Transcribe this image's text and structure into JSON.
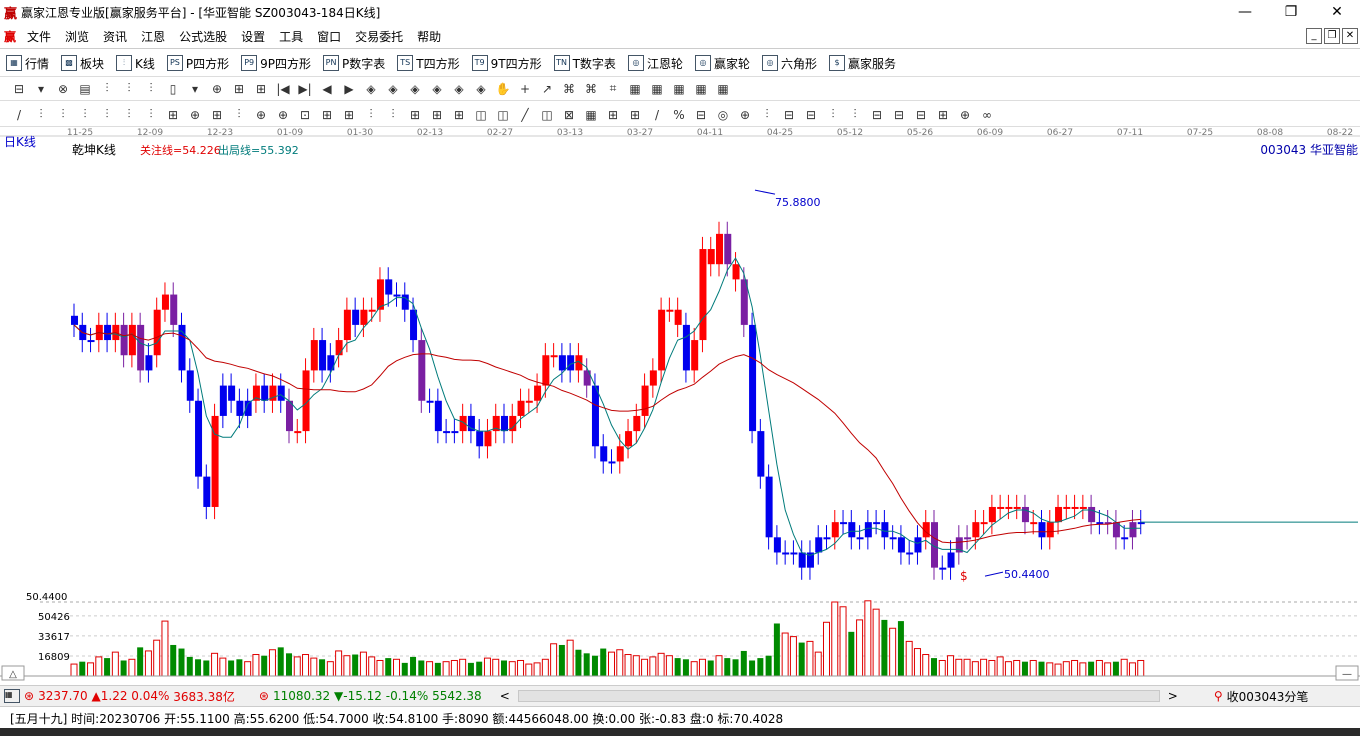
{
  "window": {
    "logo_glyph": "赢",
    "title": "赢家江恩专业版[赢家服务平台] - [华亚智能  SZ003043-184日K线]",
    "minimize": "—",
    "restore": "❐",
    "close": "✕"
  },
  "menu": {
    "items": [
      "文件",
      "浏览",
      "资讯",
      "江恩",
      "公式选股",
      "设置",
      "工具",
      "窗口",
      "交易委托",
      "帮助"
    ]
  },
  "toolbar": {
    "items": [
      {
        "icon": "▦",
        "label": "行情"
      },
      {
        "icon": "▩",
        "label": "板块"
      },
      {
        "icon": "⫶",
        "label": "K线"
      },
      {
        "icon": "PS",
        "label": "P四方形"
      },
      {
        "icon": "P9",
        "label": "9P四方形"
      },
      {
        "icon": "PN",
        "label": "P数字表"
      },
      {
        "icon": "TS",
        "label": "T四方形"
      },
      {
        "icon": "T9",
        "label": "9T四方形"
      },
      {
        "icon": "TN",
        "label": "T数字表"
      },
      {
        "icon": "◎",
        "label": "江恩轮"
      },
      {
        "icon": "◎",
        "label": "赢家轮"
      },
      {
        "icon": "◎",
        "label": "六角形"
      },
      {
        "icon": "$",
        "label": "赢家服务"
      }
    ],
    "row2_icons": [
      "⊟",
      "▾",
      "⊗",
      "▤",
      "⫶",
      "⫶",
      "⫶",
      "▯",
      "▾",
      "⊕",
      "⊞",
      "⊞",
      "|◀",
      "▶|",
      "◀",
      "▶",
      "◈",
      "◈",
      "◈",
      "◈",
      "◈",
      "◈",
      "✋",
      "+",
      "↗",
      "⌘",
      "⌘",
      "⌗",
      "▦",
      "▦",
      "▦",
      "▦",
      "▦"
    ],
    "row3_icons": [
      "/",
      "⫶",
      "⫶",
      "⫶",
      "⫶",
      "⫶",
      "⫶",
      "⊞",
      "⊕",
      "⊞",
      "⫶",
      "⊕",
      "⊕",
      "⊡",
      "⊞",
      "⊞",
      "⫶",
      "⫶",
      "⊞",
      "⊞",
      "⊞",
      "◫",
      "◫",
      "╱",
      "◫",
      "⊠",
      "▦",
      "⊞",
      "⊞",
      "/",
      "%",
      "⊟",
      "◎",
      "⊕",
      "⫶",
      "⊟",
      "⊟",
      "⫶",
      "⫶",
      "⊟",
      "⊟",
      "⊟",
      "⊞",
      "⊕",
      "∞"
    ]
  },
  "chart_header": {
    "period_label": "日K线",
    "indicator_name": "乾坤K线",
    "focus_line_label": "关注线=54.226",
    "exit_line_label": "出局线=55.392",
    "stock_code_name": "003043  华亚智能",
    "high_label": "75.8800",
    "low_label": "50.4400",
    "low_marker": "$",
    "price_axis_label": "50.4400"
  },
  "chart_data": {
    "type": "candlestick",
    "x_dates": [
      "11-25",
      "12-09",
      "12-23",
      "01-09",
      "01-30",
      "02-13",
      "02-27",
      "03-13",
      "03-27",
      "04-11",
      "04-25",
      "05-12",
      "05-26",
      "06-09",
      "06-27",
      "07-11",
      "07-25",
      "08-08",
      "08-22"
    ],
    "volume_axis_ticks": [
      "50426",
      "33617",
      "16809"
    ],
    "high": 75.88,
    "low": 50.44,
    "closes": [
      67,
      66,
      66,
      67,
      66,
      67,
      65,
      67,
      64,
      65,
      68,
      69,
      67,
      64,
      62,
      57,
      55,
      61,
      63,
      62,
      61,
      62,
      63,
      62,
      63,
      62,
      60,
      60,
      64,
      66,
      64,
      65,
      66,
      68,
      67,
      68,
      68,
      70,
      69,
      69,
      68,
      66,
      62,
      62,
      60,
      60,
      60,
      61,
      60,
      59,
      60,
      61,
      60,
      61,
      62,
      62,
      63,
      65,
      65,
      64,
      65,
      64,
      63,
      59,
      58,
      58,
      59,
      60,
      61,
      63,
      64,
      68,
      68,
      67,
      64,
      66,
      72,
      71,
      73,
      71,
      70,
      67,
      60,
      57,
      53,
      52,
      52,
      52,
      51,
      52,
      53,
      53,
      54,
      54,
      53,
      53,
      54,
      54,
      53,
      53,
      52,
      52,
      53,
      54,
      51,
      51,
      52,
      53,
      53,
      54,
      54,
      55,
      55,
      55,
      55,
      54,
      54,
      53,
      54,
      55,
      55,
      55,
      55,
      54,
      54,
      54,
      53,
      53,
      54,
      54
    ],
    "colors": [
      "b",
      "b",
      "b",
      "r",
      "b",
      "r",
      "p",
      "r",
      "p",
      "b",
      "r",
      "r",
      "p",
      "b",
      "b",
      "b",
      "b",
      "r",
      "b",
      "b",
      "b",
      "b",
      "r",
      "b",
      "r",
      "b",
      "p",
      "r",
      "r",
      "r",
      "b",
      "b",
      "r",
      "r",
      "b",
      "r",
      "r",
      "r",
      "b",
      "b",
      "b",
      "b",
      "p",
      "b",
      "b",
      "b",
      "b",
      "r",
      "b",
      "b",
      "r",
      "r",
      "b",
      "r",
      "r",
      "r",
      "r",
      "r",
      "r",
      "b",
      "b",
      "r",
      "p",
      "b",
      "b",
      "b",
      "r",
      "r",
      "r",
      "r",
      "r",
      "r",
      "r",
      "r",
      "b",
      "r",
      "r",
      "r",
      "r",
      "p",
      "r",
      "p",
      "b",
      "b",
      "b",
      "b",
      "b",
      "b",
      "b",
      "b",
      "b",
      "b",
      "r",
      "b",
      "b",
      "b",
      "b",
      "b",
      "b",
      "b",
      "b",
      "b",
      "b",
      "r",
      "p",
      "b",
      "b",
      "p",
      "p",
      "r",
      "r",
      "r",
      "r",
      "r",
      "r",
      "p",
      "r",
      "b",
      "r",
      "r",
      "r",
      "r",
      "r",
      "p",
      "b",
      "p",
      "p",
      "b",
      "p",
      "b",
      "b"
    ],
    "volumes": [
      10000,
      12000,
      11000,
      16000,
      15000,
      20000,
      13000,
      14000,
      24000,
      21000,
      30000,
      46000,
      26000,
      23000,
      16000,
      14000,
      13000,
      19000,
      15000,
      13000,
      14000,
      12000,
      18000,
      17000,
      22000,
      24000,
      19000,
      16000,
      18000,
      15000,
      14000,
      12000,
      21000,
      17000,
      18000,
      20000,
      16000,
      13000,
      15000,
      14000,
      11000,
      16000,
      13000,
      12000,
      11000,
      12000,
      13000,
      14000,
      11000,
      12000,
      15000,
      14000,
      13000,
      12000,
      13000,
      10000,
      11000,
      14000,
      27000,
      26000,
      30000,
      22000,
      19000,
      17000,
      23000,
      20000,
      22000,
      18000,
      17000,
      14000,
      16000,
      19000,
      17000,
      15000,
      14000,
      12000,
      14000,
      13000,
      17000,
      15000,
      14000,
      21000,
      13000,
      15000,
      17000,
      44000,
      36000,
      33000,
      28000,
      29000,
      20000,
      45000,
      62000,
      58000,
      37000,
      47000,
      63000,
      56000,
      47000,
      40000,
      46000,
      29000,
      23000,
      18000,
      15000,
      13000,
      17000,
      14000,
      14000,
      12000,
      14000,
      13000,
      16000,
      12000,
      13000,
      12000,
      13000,
      12000,
      11000,
      10000,
      12000,
      13000,
      11000,
      12000,
      13000,
      11000,
      12000,
      14000,
      11000,
      13000,
      12000,
      11000,
      12000,
      13000,
      11000,
      13000,
      11000,
      10000
    ],
    "ma_short": "teal",
    "ma_long": "red"
  },
  "status": {
    "sh_index": "3237.70",
    "sh_change": "▲1.22",
    "sh_pct": "0.04%",
    "sh_amount": "3683.38亿",
    "sz_index": "11080.32",
    "sz_change": "▼-15.12",
    "sz_pct": "-0.14%",
    "sz_amount": "5542.38",
    "scroll_left": "<",
    "scroll_right": ">",
    "fav_label": "收003043分笔",
    "info_line": "[五月十九] 时间:20230706 开:55.1100 高:55.6200 低:54.7000 收:54.8100 手:8090 额:44566048.00 换:0.00 张:-0.83 盘:0 标:70.4028"
  },
  "colors": {
    "up": "#ff0000",
    "down": "#0000ee",
    "mid": "#7a1fa2",
    "vol_up": "#e00000",
    "vol_down": "#008a00",
    "ma_short": "#007b7b",
    "ma_long": "#c00000"
  }
}
